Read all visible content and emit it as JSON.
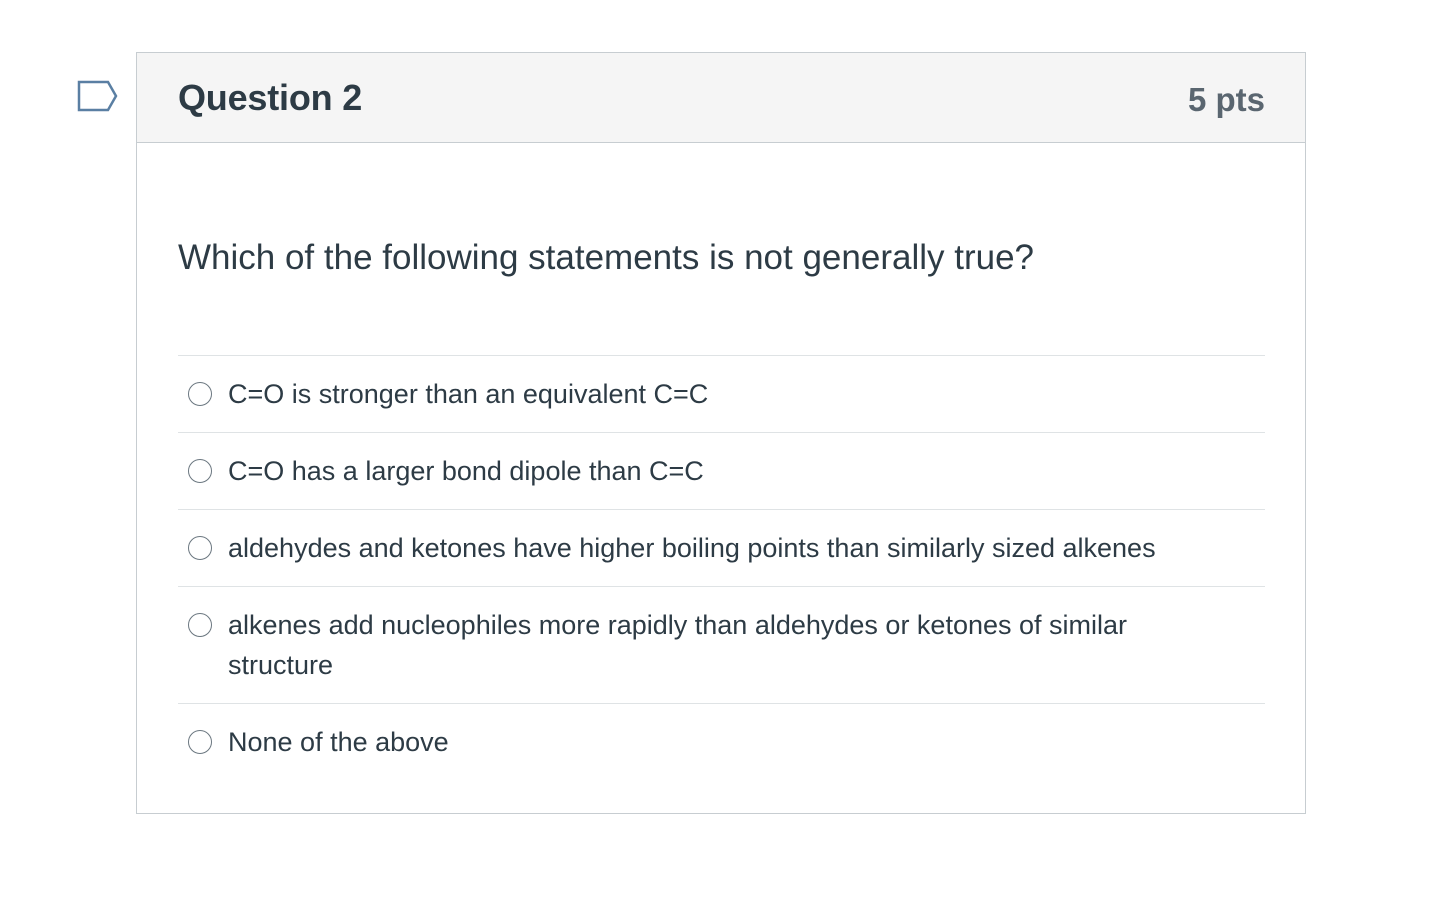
{
  "question": {
    "title": "Question 2",
    "points": "5 pts",
    "flag_icon": "flag-outline-icon",
    "text": "Which of the following statements is not generally true?",
    "answers": [
      {
        "label": "C=O is stronger than an equivalent C=C",
        "selected": false
      },
      {
        "label": "C=O has a larger bond dipole than C=C",
        "selected": false
      },
      {
        "label": "aldehydes and ketones have higher boiling points than similarly sized alkenes",
        "selected": false
      },
      {
        "label": "alkenes add nucleophiles more rapidly than aldehydes or ketones of similar structure",
        "selected": false
      },
      {
        "label": "None of the above",
        "selected": false
      }
    ]
  },
  "colors": {
    "text": "#2d3b45",
    "header_bg": "#f5f5f5",
    "border": "#c7cdd1",
    "flag": "#5a7fa3"
  }
}
